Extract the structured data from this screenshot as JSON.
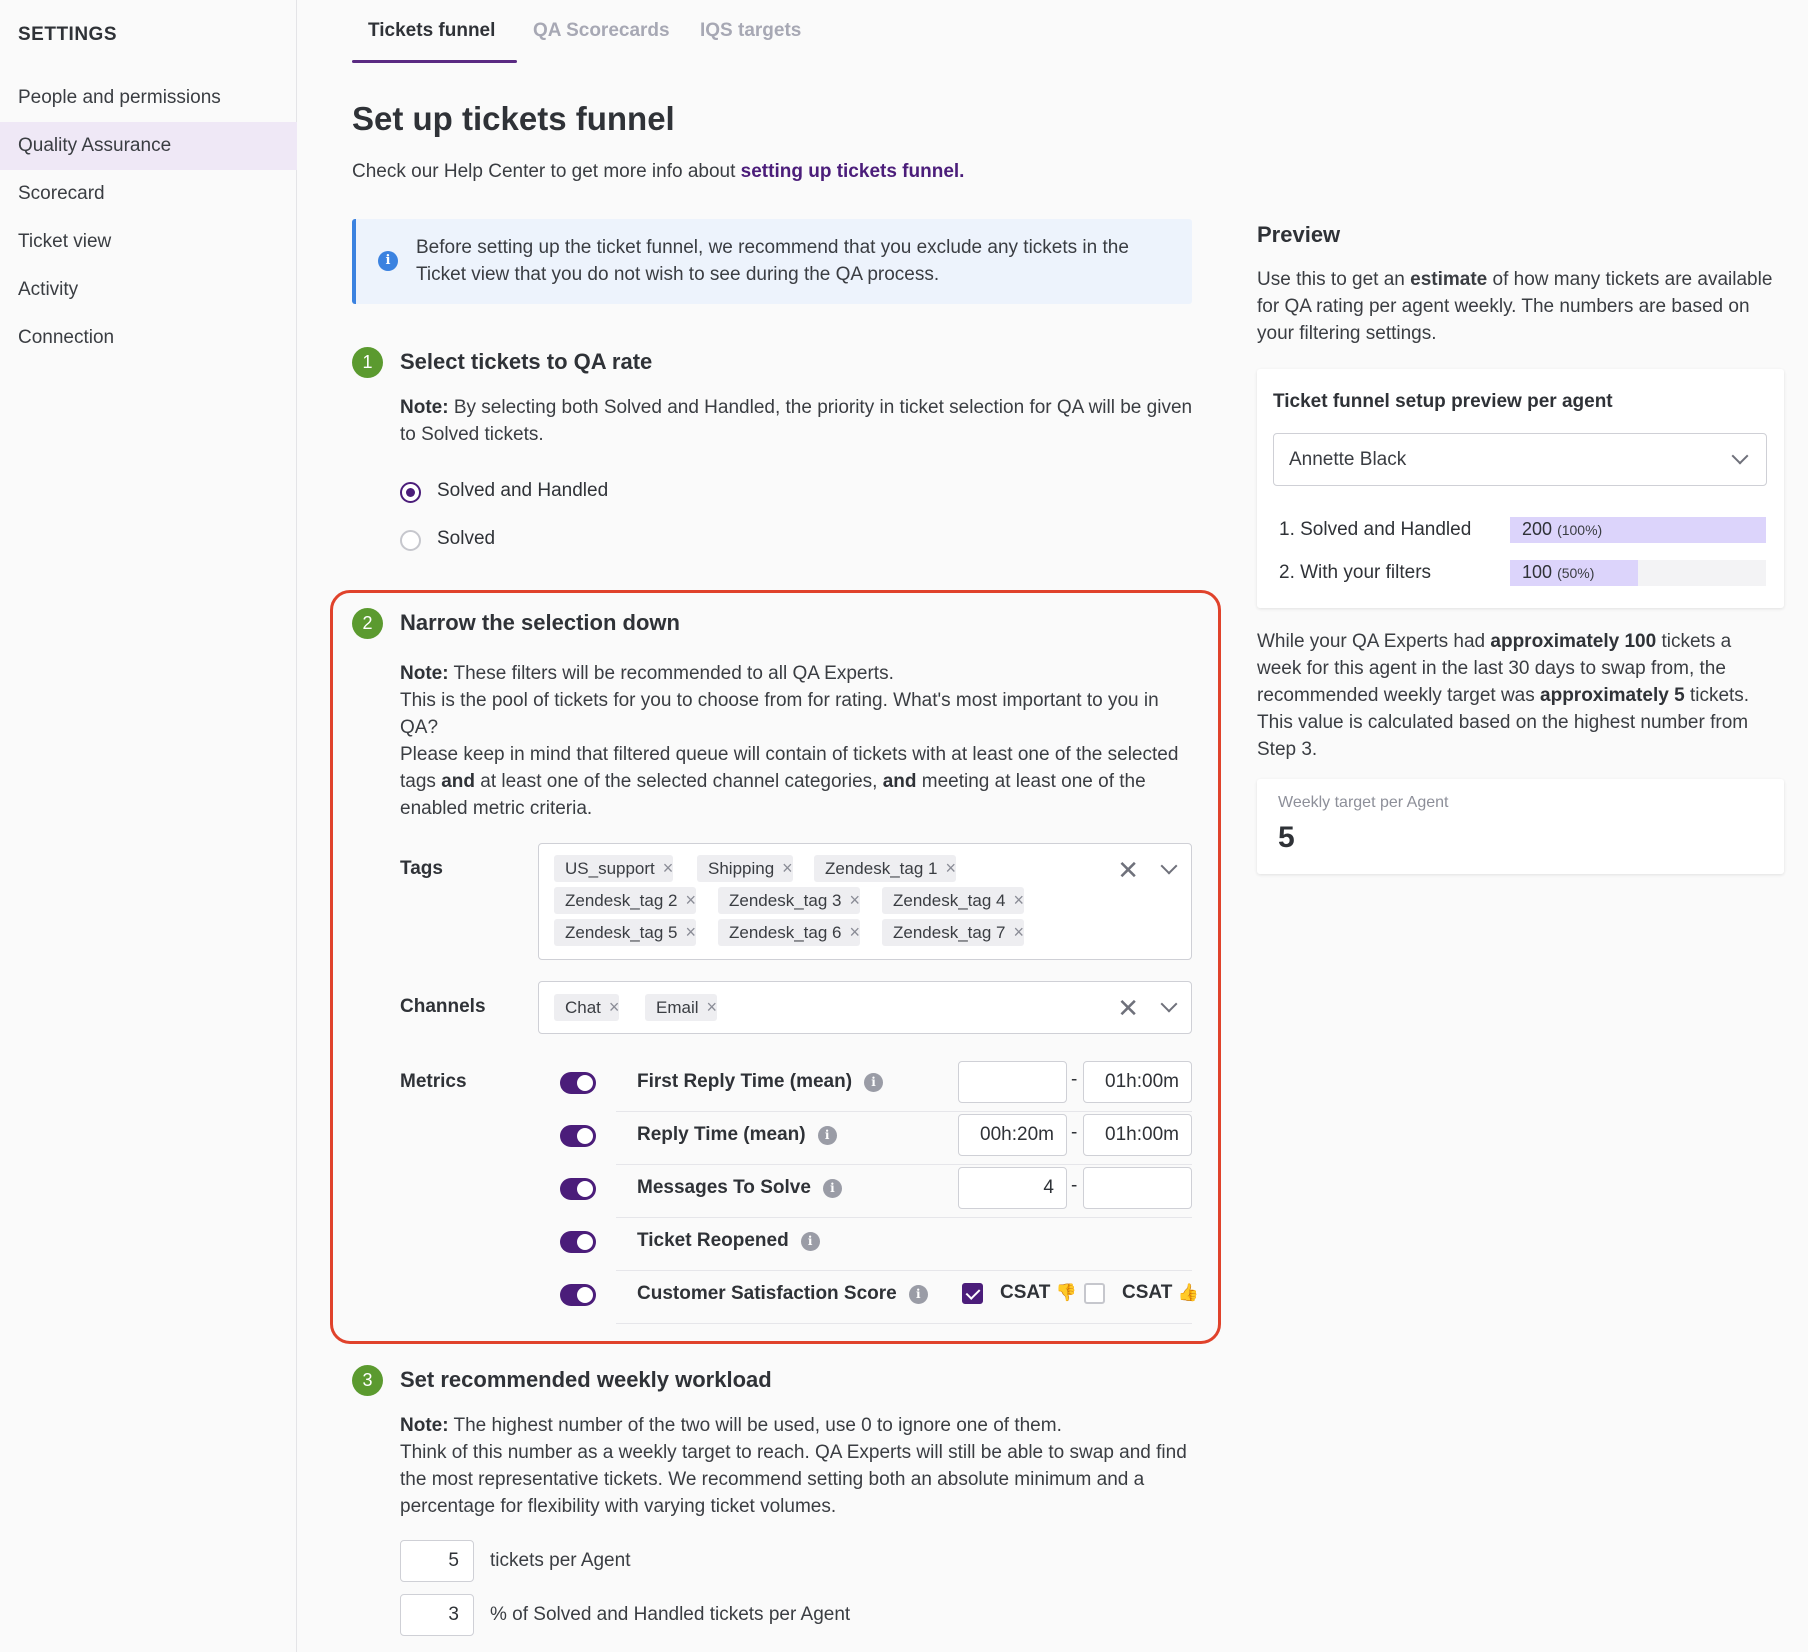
{
  "sidebar": {
    "title": "SETTINGS",
    "items": [
      {
        "label": "People and permissions",
        "active": false
      },
      {
        "label": "Quality Assurance",
        "active": true
      },
      {
        "label": "Scorecard",
        "active": false
      },
      {
        "label": "Ticket view",
        "active": false
      },
      {
        "label": "Activity",
        "active": false
      },
      {
        "label": "Connection",
        "active": false
      }
    ]
  },
  "tabs": [
    {
      "label": "Tickets funnel",
      "active": true
    },
    {
      "label": "QA Scorecards",
      "active": false
    },
    {
      "label": "IQS targets",
      "active": false
    }
  ],
  "page": {
    "title": "Set up tickets funnel",
    "help_prefix": "Check our Help Center to get more info about ",
    "help_link": "setting up tickets funnel.",
    "info_icon": "info-icon",
    "info_text": "Before setting up the ticket funnel, we recommend that you exclude any tickets in the Ticket view that you do not wish to see during the QA process."
  },
  "step1": {
    "number": "1",
    "title": "Select tickets to QA rate",
    "note_label": "Note:",
    "note_text": " By selecting both Solved and Handled, the priority in ticket selection for QA will be given to Solved tickets.",
    "options": [
      {
        "label": "Solved and Handled",
        "checked": true
      },
      {
        "label": "Solved",
        "checked": false
      }
    ]
  },
  "step2": {
    "number": "2",
    "title": "Narrow the selection down",
    "note_label": "Note:",
    "note_text": " These filters will be recommended to all QA Experts.",
    "line2": "This is the pool of tickets for you to choose from for rating. What's most important to you in QA?",
    "line3_a": "Please keep in mind that filtered queue will contain of tickets with at least one of the selected tags ",
    "and1": "and",
    "line3_b": " at least one of the selected channel categories, ",
    "and2": "and",
    "line3_c": " meeting at least one of the enabled metric criteria.",
    "tags_label": "Tags",
    "tags": [
      "US_support",
      "Shipping",
      "Zendesk_tag 1",
      "Zendesk_tag 2",
      "Zendesk_tag 3",
      "Zendesk_tag 4",
      "Zendesk_tag 5",
      "Zendesk_tag 6",
      "Zendesk_tag 7"
    ],
    "channels_label": "Channels",
    "channels": [
      "Chat",
      "Email"
    ],
    "chip_remove": "×",
    "clear_icon": "✕",
    "metrics_label": "Metrics",
    "metrics": [
      {
        "name": "First Reply Time (mean)",
        "enabled": true,
        "min": "",
        "max": "01h:00m"
      },
      {
        "name": "Reply Time (mean)",
        "enabled": true,
        "min": "00h:20m",
        "max": "01h:00m"
      },
      {
        "name": "Messages To Solve",
        "enabled": true,
        "min": "4",
        "max": ""
      },
      {
        "name": "Ticket Reopened",
        "enabled": true
      },
      {
        "name": "Customer Satisfaction Score",
        "enabled": true
      }
    ],
    "range_dash": "-",
    "csat_down": {
      "label": "CSAT",
      "icon": "👎",
      "checked": true
    },
    "csat_up": {
      "label": "CSAT",
      "icon": "👍",
      "checked": false
    }
  },
  "step3": {
    "number": "3",
    "title": "Set recommended weekly workload",
    "note_label": "Note:",
    "note_text": " The highest number of the two will be used, use 0 to ignore one of them.",
    "line2": "Think of this number as a weekly target to reach. QA Experts will still be able to swap and find the most representative tickets. We recommend setting both an absolute minimum and a percentage for flexibility with varying ticket volumes.",
    "tickets_value": "5",
    "tickets_label": "tickets per Agent",
    "percent_value": "3",
    "percent_label": "% of Solved and Handled tickets per Agent"
  },
  "preview": {
    "title": "Preview",
    "text_a": "Use this to get an ",
    "text_bold": "estimate",
    "text_b": " of how many tickets are available for QA rating per agent weekly. The numbers are based on your filtering settings.",
    "card_title": "Ticket funnel setup preview per agent",
    "agent": "Annette Black",
    "bars": [
      {
        "label": "1. Solved and Handled",
        "value": "200",
        "pct": "(100%)",
        "fraction": 1.0
      },
      {
        "label": "2. With your filters",
        "value": "100",
        "pct": "(50%)",
        "fraction": 0.5
      }
    ],
    "est_a": "While your QA Experts had ",
    "est_b1": "approximately 100",
    "est_c": " tickets a week for this agent in the last 30 days to swap from, the recommended weekly target was ",
    "est_b2": "approximately 5",
    "est_d": " tickets. This value is calculated based on the highest number from Step 3.",
    "target_label": "Weekly target per Agent",
    "target_value": "5"
  },
  "colors": {
    "accent": "#4b1d7a",
    "step_green": "#5b9a2f",
    "highlight": "#e0422b",
    "info_blue": "#3b82e0"
  }
}
